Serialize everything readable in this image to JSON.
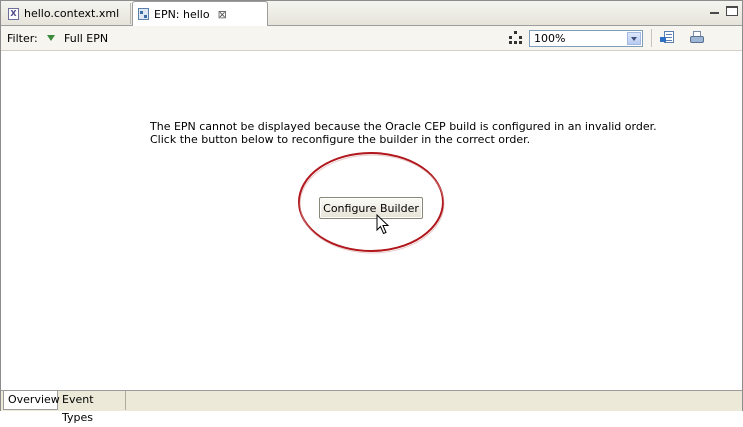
{
  "tabs": [
    {
      "label": "hello.context.xml",
      "icon": "xml-file-icon",
      "active": false
    },
    {
      "label": "EPN: hello",
      "icon": "epn-diagram-icon",
      "active": true,
      "close_glyph": "⊠"
    }
  ],
  "toolbar": {
    "filter_label": "Filter:",
    "filter_value": "Full EPN",
    "zoom_value": "100%"
  },
  "main": {
    "message_line1": "The EPN cannot be displayed because the Oracle CEP build is configured in an invalid order.",
    "message_line2": "Click the button below to reconfigure the builder in the correct order.",
    "configure_button_label": "Configure Builder"
  },
  "bottom_tabs": [
    {
      "label": "Overview",
      "active": true
    },
    {
      "label": "Event Types",
      "active": false
    }
  ],
  "colors": {
    "highlight_ellipse": "#b0161b",
    "filter_arrow": "#3b8a3b"
  }
}
